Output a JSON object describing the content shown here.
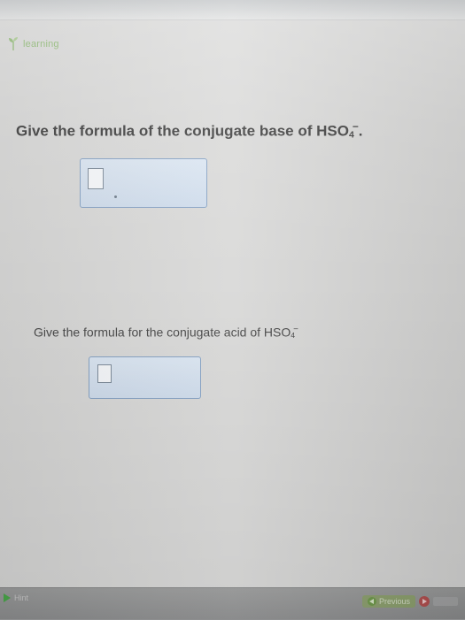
{
  "header": {
    "brand_text": "learning"
  },
  "questions": [
    {
      "prefix": "Give the formula of the conjugate base of HSO",
      "subscript": "4",
      "superscript": "−",
      "suffix": "."
    },
    {
      "prefix": "Give the formula for the conjugate acid of HSO",
      "subscript": "4",
      "superscript": "−",
      "suffix": ""
    }
  ],
  "footer": {
    "hint_label": "Hint",
    "previous_label": "Previous"
  },
  "colors": {
    "brand_green": "#8bb86f",
    "answer_box_border": "#86a2c4",
    "answer_box_fill": "#d4e0ee"
  }
}
